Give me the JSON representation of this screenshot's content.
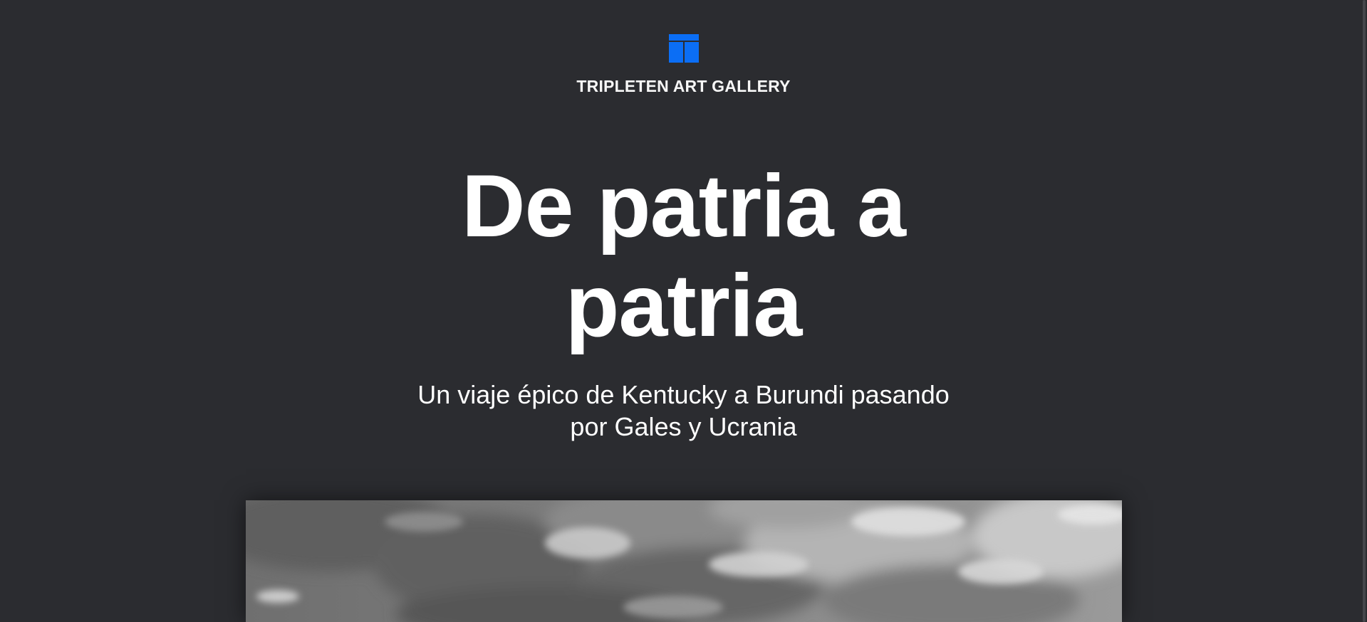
{
  "header": {
    "logo_icon": "gallery-logo-icon",
    "brand_name": "TRIPLETEN ART GALLERY",
    "accent_color": "#0b6ef5"
  },
  "hero": {
    "title_line_1": "De patria a",
    "title_line_2": "patria",
    "subtitle_line_1": "Un viaje épico de Kentucky a Burundi pasando",
    "subtitle_line_2": "por Gales y Ucrania"
  },
  "hero_image": {
    "description_icon": "cloudy-sky-photo"
  },
  "colors": {
    "background": "#2b2c30",
    "text": "#ffffff"
  }
}
